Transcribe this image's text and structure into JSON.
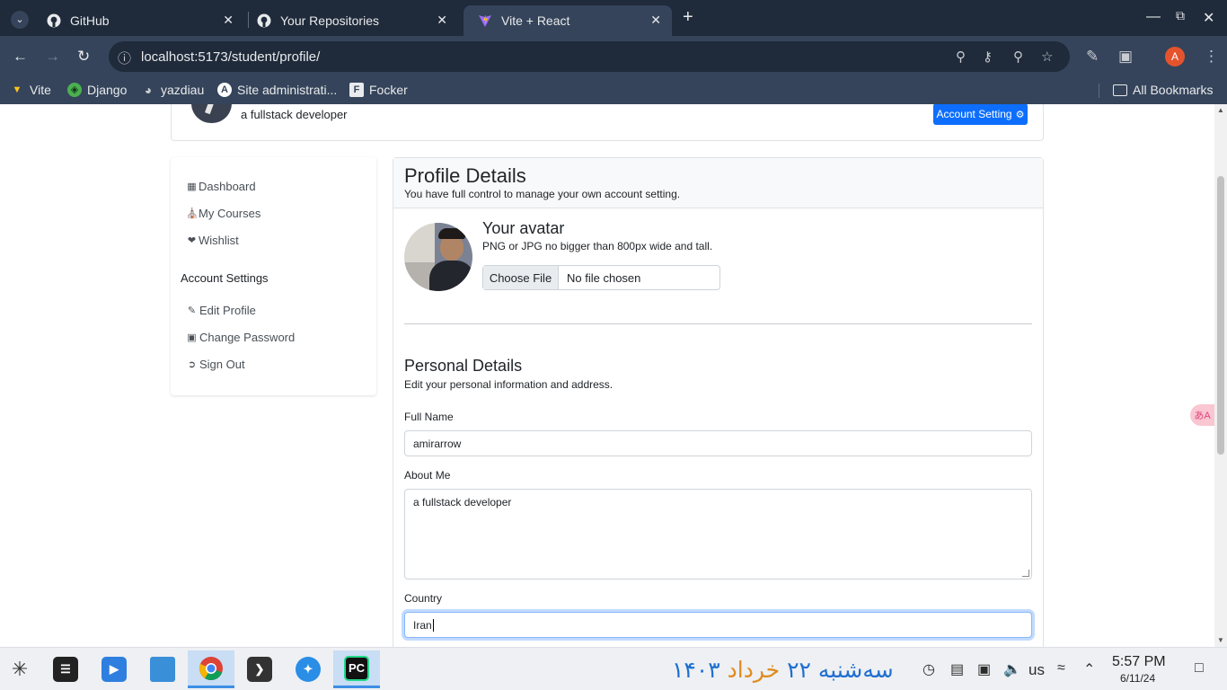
{
  "browser": {
    "tabs": [
      {
        "title": "GitHub",
        "icon": "github-icon"
      },
      {
        "title": "Your Repositories",
        "icon": "github-icon"
      },
      {
        "title": "Vite + React",
        "icon": "vite-icon",
        "active": true
      }
    ],
    "url": "localhost:5173/student/profile/",
    "bookmarks": [
      {
        "label": "Vite",
        "icon": "vite-icon"
      },
      {
        "label": "Django",
        "icon": "django-icon"
      },
      {
        "label": "yazdiau",
        "icon": "globe-icon"
      },
      {
        "label": "Site administrati...",
        "icon": "admin-icon"
      },
      {
        "label": "Focker",
        "icon": "focker-icon"
      }
    ],
    "all_bookmarks": "All Bookmarks",
    "profile_initial": "A"
  },
  "header": {
    "about": "a fullstack developer",
    "account_button": "Account Setting"
  },
  "sidebar": {
    "items": [
      {
        "label": "Dashboard",
        "icon": "grid-icon"
      },
      {
        "label": "My Courses",
        "icon": "cart-icon"
      },
      {
        "label": "Wishlist",
        "icon": "heart-icon"
      }
    ],
    "section_heading": "Account Settings",
    "settings_items": [
      {
        "label": "Edit Profile",
        "icon": "edit-icon"
      },
      {
        "label": "Change Password",
        "icon": "lock-icon"
      },
      {
        "label": "Sign Out",
        "icon": "sign-out-icon"
      }
    ]
  },
  "profile": {
    "title": "Profile Details",
    "subtitle": "You have full control to manage your own account setting.",
    "avatar_title": "Your avatar",
    "avatar_hint": "PNG or JPG no bigger than 800px wide and tall.",
    "file_button": "Choose File",
    "file_status": "No file chosen"
  },
  "personal": {
    "title": "Personal Details",
    "subtitle": "Edit your personal information and address.",
    "full_name_label": "Full Name",
    "full_name_value": "amirarrow",
    "about_label": "About Me",
    "about_value": "a fullstack developer",
    "country_label": "Country",
    "country_value": "Iran"
  },
  "taskbar": {
    "jalali_weekday": "سه‌شنبه",
    "jalali_day": "۲۲",
    "jalali_month": "خرداد",
    "jalali_year": "۱۴۰۳",
    "keyboard_layout": "us",
    "time": "5:57 PM",
    "date": "6/11/24"
  }
}
